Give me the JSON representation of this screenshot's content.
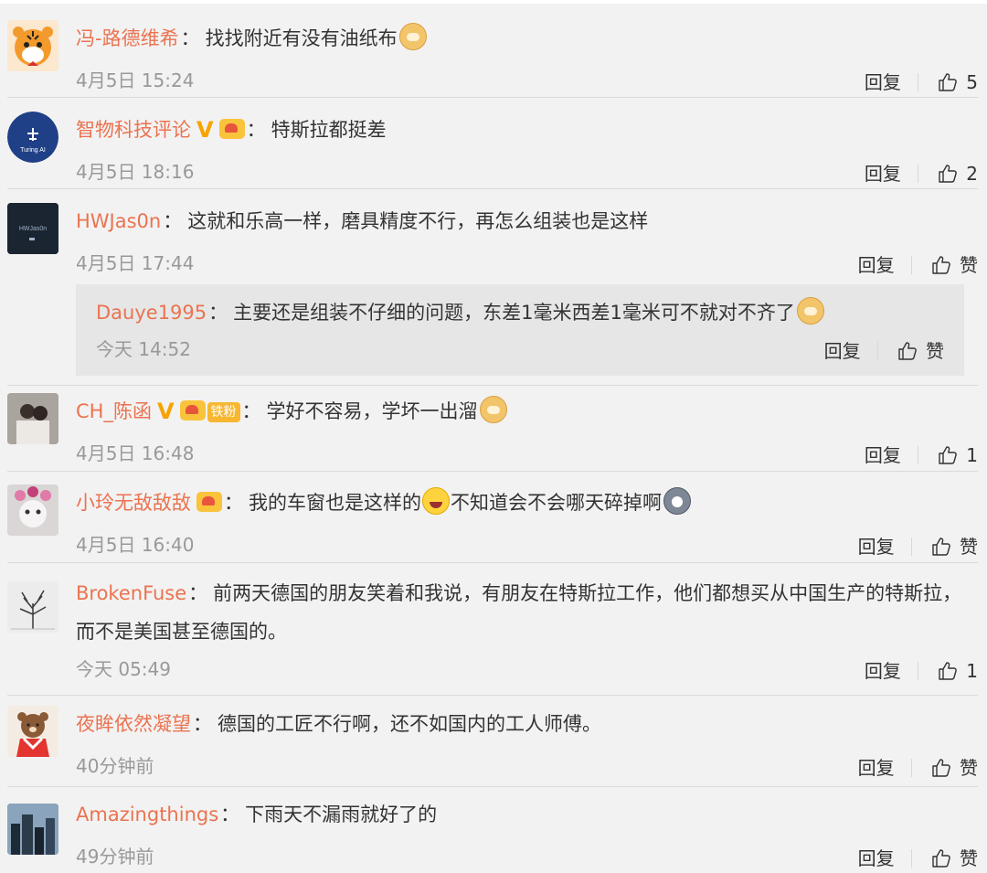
{
  "comments": [
    {
      "user": "冯-路德维希",
      "text": "找找附近有没有油纸布",
      "time": "4月5日 15:24",
      "reply": "回复",
      "likes": "5"
    },
    {
      "user": "智物科技评论",
      "text": "特斯拉都挺差",
      "time": "4月5日 18:16",
      "reply": "回复",
      "likes": "2",
      "avatar_text": "Turing AI"
    },
    {
      "user": "HWJas0n",
      "text": "这就和乐高一样，磨具精度不行，再怎么组装也是这样",
      "time": "4月5日 17:44",
      "reply": "回复",
      "likes": "赞",
      "avatar_text": "HWJas0n"
    },
    {
      "user": "CH_陈函",
      "text": "学好不容易，学坏一出溜",
      "time": "4月5日 16:48",
      "reply": "回复",
      "likes": "1",
      "fan_badge": "铁粉"
    },
    {
      "user": "小玲无敌敌敌",
      "text_a": "我的车窗也是这样的",
      "text_b": "不知道会不会哪天碎掉啊",
      "time": "4月5日 16:40",
      "reply": "回复",
      "likes": "赞"
    },
    {
      "user": "BrokenFuse",
      "text": "前两天德国的朋友笑着和我说，有朋友在特斯拉工作，他们都想买从中国生产的特斯拉，而不是美国甚至德国的。",
      "time": "今天 05:49",
      "reply": "回复",
      "likes": "1"
    },
    {
      "user": "夜眸依然凝望",
      "text": "德国的工匠不行啊，还不如国内的工人师傅。",
      "time": "40分钟前",
      "reply": "回复",
      "likes": "赞"
    },
    {
      "user": "Amazingthings",
      "text": "下雨天不漏雨就好了的",
      "time": "49分钟前",
      "reply": "回复",
      "likes": "赞"
    }
  ],
  "subreply": {
    "user": "Dauye1995",
    "text": "主要还是组装不仔细的问题，东差1毫米西差1毫米可不就对不齐了",
    "time": "今天 14:52",
    "reply": "回复",
    "likes": "赞"
  },
  "colon": "："
}
